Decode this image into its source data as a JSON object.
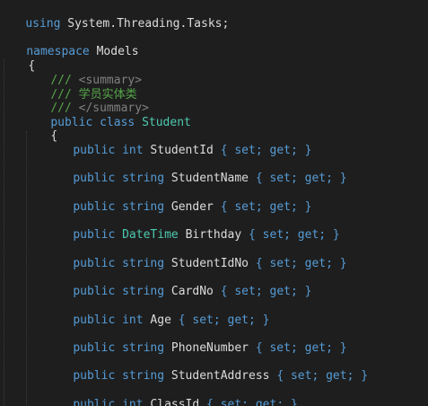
{
  "code": {
    "using_kw": "using",
    "using_ns": "System.Threading.Tasks;",
    "namespace_kw": "namespace",
    "namespace_name": "Models",
    "open_brace_ns": "{",
    "doc_prefix": "///",
    "summary_open": "<summary>",
    "summary_text": "学员实体类",
    "summary_close": "</summary>",
    "class_public": "public",
    "class_kw": "class",
    "class_name": "Student",
    "open_brace_class": "{",
    "accessors": "{ set; get; }",
    "properties": [
      {
        "modifier": "public",
        "type": "int",
        "name": "StudentId"
      },
      {
        "modifier": "public",
        "type": "string",
        "name": "StudentName"
      },
      {
        "modifier": "public",
        "type": "string",
        "name": "Gender"
      },
      {
        "modifier": "public",
        "type": "DateTime",
        "name": "Birthday"
      },
      {
        "modifier": "public",
        "type": "string",
        "name": "StudentIdNo"
      },
      {
        "modifier": "public",
        "type": "string",
        "name": "CardNo"
      },
      {
        "modifier": "public",
        "type": "int",
        "name": "Age"
      },
      {
        "modifier": "public",
        "type": "string",
        "name": "PhoneNumber"
      },
      {
        "modifier": "public",
        "type": "string",
        "name": "StudentAddress"
      },
      {
        "modifier": "public",
        "type": "int",
        "name": "ClassId"
      }
    ]
  },
  "colors": {
    "background": "#1e1e1e",
    "keyword": "#569cd6",
    "type": "#4ec9b0",
    "comment": "#57a64a",
    "xml_tag": "#808080",
    "text": "#dcdcdc"
  }
}
